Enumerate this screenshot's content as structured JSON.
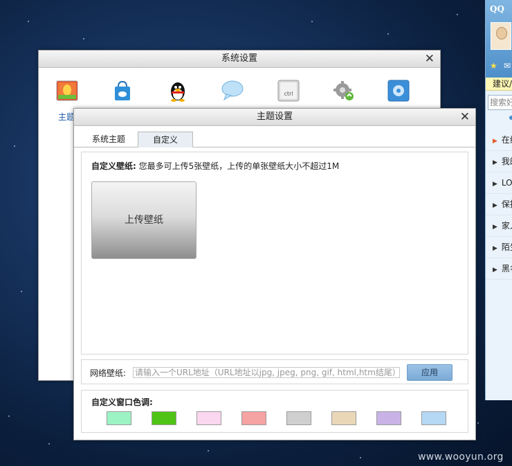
{
  "qq_panel": {
    "logo": "QQ",
    "suggest": "建议/",
    "search_placeholder": "搜索好",
    "groups": [
      "在线",
      "我的",
      "LO",
      "保持",
      "家人",
      "陌生",
      "黑名"
    ]
  },
  "system_window": {
    "title": "系统设置",
    "theme_label": "主题",
    "icons": [
      "theme-icon",
      "shopping-bag-icon",
      "qq-penguin-icon",
      "chat-bubble-icon",
      "ctrl-key-icon",
      "gear-sync-icon",
      "settings-panel-icon"
    ],
    "ctrl_text": "ctrl"
  },
  "theme_window": {
    "title": "主题设置",
    "tabs": [
      "系统主题",
      "自定义"
    ],
    "active_tab": "自定义",
    "custom_wallpaper": {
      "label": "自定义壁纸:",
      "note": "您最多可上传5张壁纸，上传的单张壁纸大小不超过1M",
      "upload_label": "上传壁纸"
    },
    "network_wallpaper": {
      "label": "网络壁纸:",
      "placeholder": "请输入一个URL地址（URL地址以jpg, jpeg, png, gif, html,htm结尾）",
      "apply_label": "应用"
    },
    "color_tone": {
      "label": "自定义窗口色调:",
      "colors": [
        "#9cf3c4",
        "#4fc416",
        "#fbd6ef",
        "#f6a3a3",
        "#cfcfcf",
        "#ead7b8",
        "#c9b3e6",
        "#b5d8f5"
      ]
    }
  },
  "watermark": "www.wooyun.org"
}
